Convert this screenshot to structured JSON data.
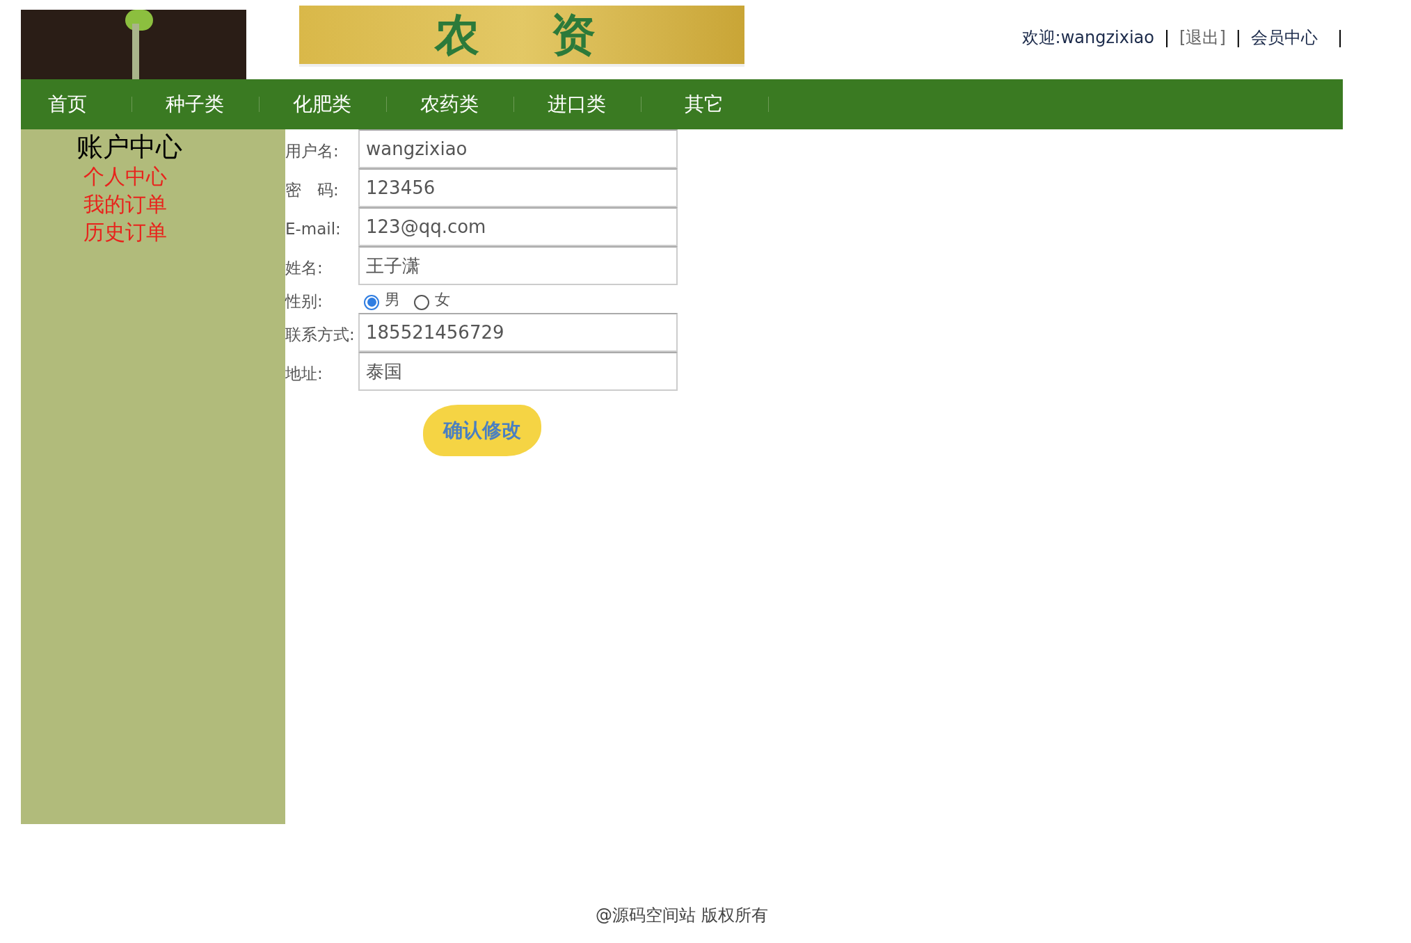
{
  "banner": {
    "text": "农　资"
  },
  "user_bar": {
    "welcome": "欢迎:wangzixiao",
    "separator_1": "|",
    "logout": "[退出]",
    "separator_2": "|",
    "member_center": "会员中心",
    "separator_3": "|"
  },
  "nav": [
    {
      "label": "首页"
    },
    {
      "label": "种子类"
    },
    {
      "label": "化肥类"
    },
    {
      "label": "农药类"
    },
    {
      "label": "进口类"
    },
    {
      "label": "其它"
    }
  ],
  "sidebar": {
    "title": "账户中心",
    "items": [
      "个人中心",
      "我的订单",
      "历史订单"
    ]
  },
  "form": {
    "fields": [
      {
        "kind": "text",
        "label": "用户名:",
        "value": "wangzixiao"
      },
      {
        "kind": "text",
        "label": "密　码:",
        "value": "123456"
      },
      {
        "kind": "text",
        "label": "E-mail:",
        "value": "123@qq.com"
      },
      {
        "kind": "text",
        "label": "姓名:",
        "value": "王子潇"
      },
      {
        "kind": "radio",
        "label": "性别:",
        "options": [
          {
            "label": "男",
            "selected": true
          },
          {
            "label": "女",
            "selected": false
          }
        ]
      },
      {
        "kind": "text",
        "label": "联系方式:",
        "value": "185521456729"
      },
      {
        "kind": "text",
        "label": "地址:",
        "value": "泰国"
      }
    ],
    "submit": "确认修改"
  },
  "footer": "@源码空间站 版权所有"
}
